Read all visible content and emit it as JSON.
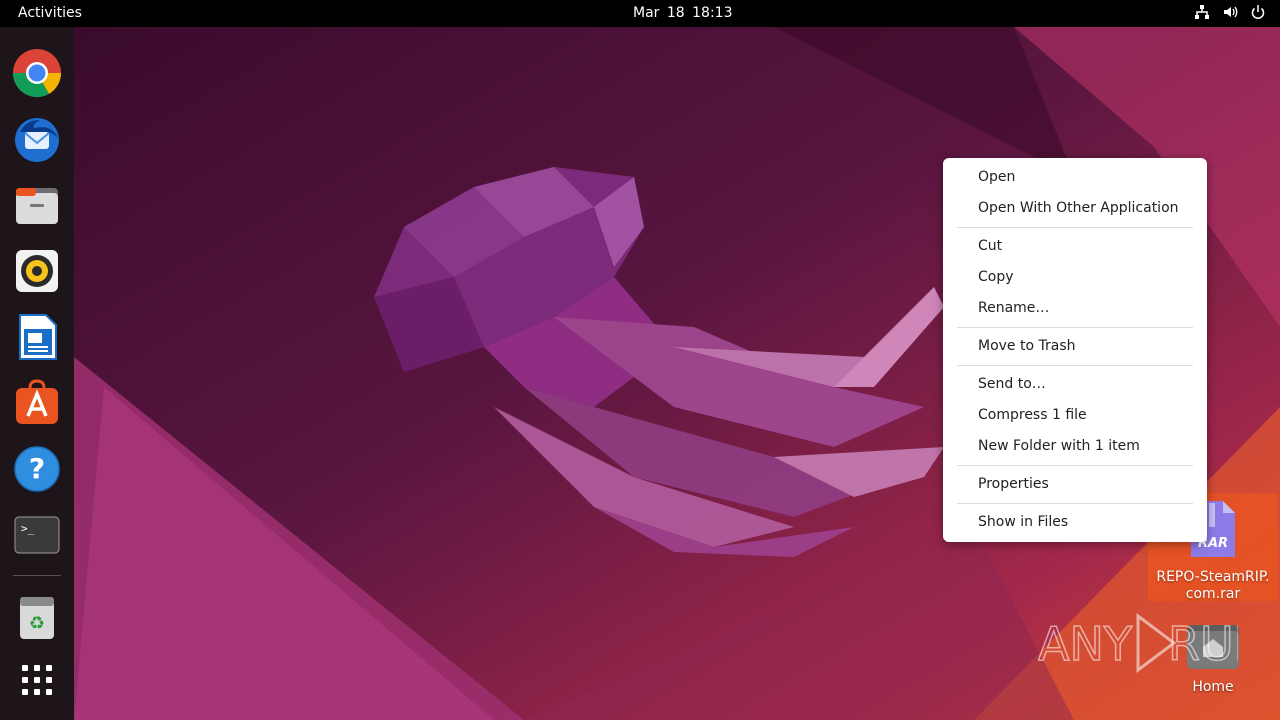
{
  "topbar": {
    "activities_label": "Activities",
    "clock": "Mar 18  18:13",
    "tray_icons": [
      "network-icon",
      "volume-icon",
      "power-icon"
    ]
  },
  "dock": {
    "items": [
      {
        "name": "Google Chrome",
        "icon": "chrome-icon"
      },
      {
        "name": "Thunderbird Mail",
        "icon": "thunderbird-icon"
      },
      {
        "name": "Files",
        "icon": "files-icon"
      },
      {
        "name": "Rhythmbox",
        "icon": "rhythmbox-icon"
      },
      {
        "name": "LibreOffice Writer",
        "icon": "writer-icon"
      },
      {
        "name": "Ubuntu Software",
        "icon": "software-store-icon"
      },
      {
        "name": "Help",
        "icon": "help-icon"
      },
      {
        "name": "Terminal",
        "icon": "terminal-icon"
      },
      {
        "name": "Trash",
        "icon": "trash-icon"
      },
      {
        "name": "Show Applications",
        "icon": "app-grid-icon"
      }
    ]
  },
  "desktop": {
    "rar_file": {
      "line1": "REPO-SteamRIP.",
      "line2": "com.rar",
      "badge": "RAR"
    },
    "home_folder": {
      "label": "Home"
    },
    "watermark": "ANY RUN"
  },
  "context_menu": {
    "groups": [
      [
        "Open",
        "Open With Other Application"
      ],
      [
        "Cut",
        "Copy",
        "Rename…"
      ],
      [
        "Move to Trash"
      ],
      [
        "Send to…",
        "Compress 1 file",
        "New Folder with 1 item"
      ],
      [
        "Properties"
      ],
      [
        "Show in Files"
      ]
    ]
  },
  "colors": {
    "accent": "#e95420",
    "wallpaper_dark": "#3b0a2e",
    "wallpaper_mid": "#7a1e4f",
    "dock_bg": "#1d1519"
  }
}
